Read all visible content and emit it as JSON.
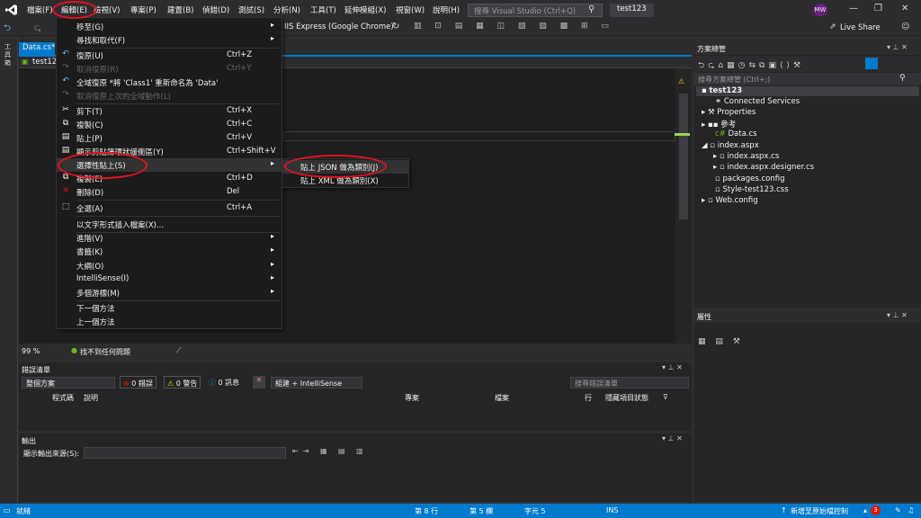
{
  "menubar": [
    "檔案(F)",
    "編輯(E)",
    "檢視(V)",
    "專案(P)",
    "建置(B)",
    "偵錯(D)",
    "測試(S)",
    "分析(N)",
    "工具(T)",
    "延伸模組(X)",
    "視窗(W)",
    "說明(H)"
  ],
  "search_placeholder": "搜尋 Visual Studio (Ctrl+Q)",
  "project_name": "test123",
  "avatar": "MW",
  "live_share": "Live Share",
  "run_target": "IIS Express (Google Chrome)",
  "left_strip_label": "工具箱",
  "editor": {
    "tab": "Data.cs*",
    "nav_project": "test12",
    "zoom": "99 %",
    "status": "找不到任何問題"
  },
  "edit_menu": [
    {
      "label": "移至(G)",
      "shortcut": "",
      "submenu": true,
      "disabled": false,
      "icon": ""
    },
    {
      "label": "尋找和取代(F)",
      "shortcut": "",
      "submenu": true,
      "disabled": false,
      "icon": ""
    },
    {
      "label": "復原(U)",
      "shortcut": "Ctrl+Z",
      "submenu": false,
      "disabled": false,
      "icon": "↶"
    },
    {
      "label": "取消復原(R)",
      "shortcut": "Ctrl+Y",
      "submenu": false,
      "disabled": true,
      "icon": "↷"
    },
    {
      "label": "全域復原 *將 'Class1' 重新命名為 'Data'",
      "shortcut": "",
      "submenu": false,
      "disabled": false,
      "icon": "↶"
    },
    {
      "label": "取消復原上次的全域動作(L)",
      "shortcut": "",
      "submenu": false,
      "disabled": true,
      "icon": "↷"
    },
    {
      "label": "剪下(T)",
      "shortcut": "Ctrl+X",
      "submenu": false,
      "disabled": false,
      "icon": "✂"
    },
    {
      "label": "複製(C)",
      "shortcut": "Ctrl+C",
      "submenu": false,
      "disabled": false,
      "icon": "⧉"
    },
    {
      "label": "貼上(P)",
      "shortcut": "Ctrl+V",
      "submenu": false,
      "disabled": false,
      "icon": "📋"
    },
    {
      "label": "顯示剪貼簿環狀緩衝區(Y)",
      "shortcut": "Ctrl+Shift+V",
      "submenu": false,
      "disabled": false,
      "icon": "📋"
    },
    {
      "label": "選擇性貼上(S)",
      "shortcut": "",
      "submenu": true,
      "disabled": false,
      "icon": ""
    },
    {
      "label": "複製(E)",
      "shortcut": "Ctrl+D",
      "submenu": false,
      "disabled": false,
      "icon": "⧉"
    },
    {
      "label": "刪除(D)",
      "shortcut": "Del",
      "submenu": false,
      "disabled": false,
      "icon": "✕"
    },
    {
      "label": "全選(A)",
      "shortcut": "Ctrl+A",
      "submenu": false,
      "disabled": false,
      "icon": "⬚"
    },
    {
      "label": "以文字形式插入檔案(X)...",
      "shortcut": "",
      "submenu": false,
      "disabled": false,
      "icon": ""
    },
    {
      "label": "進階(V)",
      "shortcut": "",
      "submenu": true,
      "disabled": false,
      "icon": ""
    },
    {
      "label": "書籤(K)",
      "shortcut": "",
      "submenu": true,
      "disabled": false,
      "icon": ""
    },
    {
      "label": "大綱(O)",
      "shortcut": "",
      "submenu": true,
      "disabled": false,
      "icon": ""
    },
    {
      "label": "IntelliSense(I)",
      "shortcut": "",
      "submenu": true,
      "disabled": false,
      "icon": ""
    },
    {
      "label": "多個游標(M)",
      "shortcut": "",
      "submenu": true,
      "disabled": false,
      "icon": ""
    },
    {
      "label": "下一個方法",
      "shortcut": "",
      "submenu": false,
      "disabled": false,
      "icon": ""
    },
    {
      "label": "上一個方法",
      "shortcut": "",
      "submenu": false,
      "disabled": false,
      "icon": ""
    }
  ],
  "paste_special_menu": [
    "貼上 JSON 做為類別(J)",
    "貼上 XML 做為類別(X)"
  ],
  "error_list": {
    "title": "錯誤清單",
    "scope": "整個方案",
    "errors": "0 錯誤",
    "warnings": "0 警告",
    "messages": "0 訊息",
    "build_filter": "組建 + IntelliSense",
    "search_placeholder": "搜尋錯誤清單",
    "columns": [
      "程式碼",
      "說明",
      "專案",
      "檔案",
      "行",
      "隱藏項目狀態"
    ]
  },
  "output": {
    "title": "輸出",
    "source_label": "顯示輸出來源(S):"
  },
  "solution_explorer": {
    "title": "方案總管",
    "search_placeholder": "搜尋方案總管 (Ctrl+;)",
    "items": [
      "test123",
      "Connected Services",
      "Properties",
      "參考",
      "Data.cs",
      "index.aspx",
      "index.aspx.cs",
      "index.aspx.designer.cs",
      "packages.config",
      "Style-test123.css",
      "Web.config"
    ]
  },
  "properties": {
    "title": "屬性"
  },
  "statusbar": {
    "ready": "就緒",
    "line": "第 8 行",
    "col": "第 5 欄",
    "char": "字元 5",
    "ins": "INS",
    "source_control": "新增至原始檔控制",
    "notifications": "3"
  },
  "colors": {
    "accent": "#007acc",
    "annotation": "#e1131f"
  }
}
